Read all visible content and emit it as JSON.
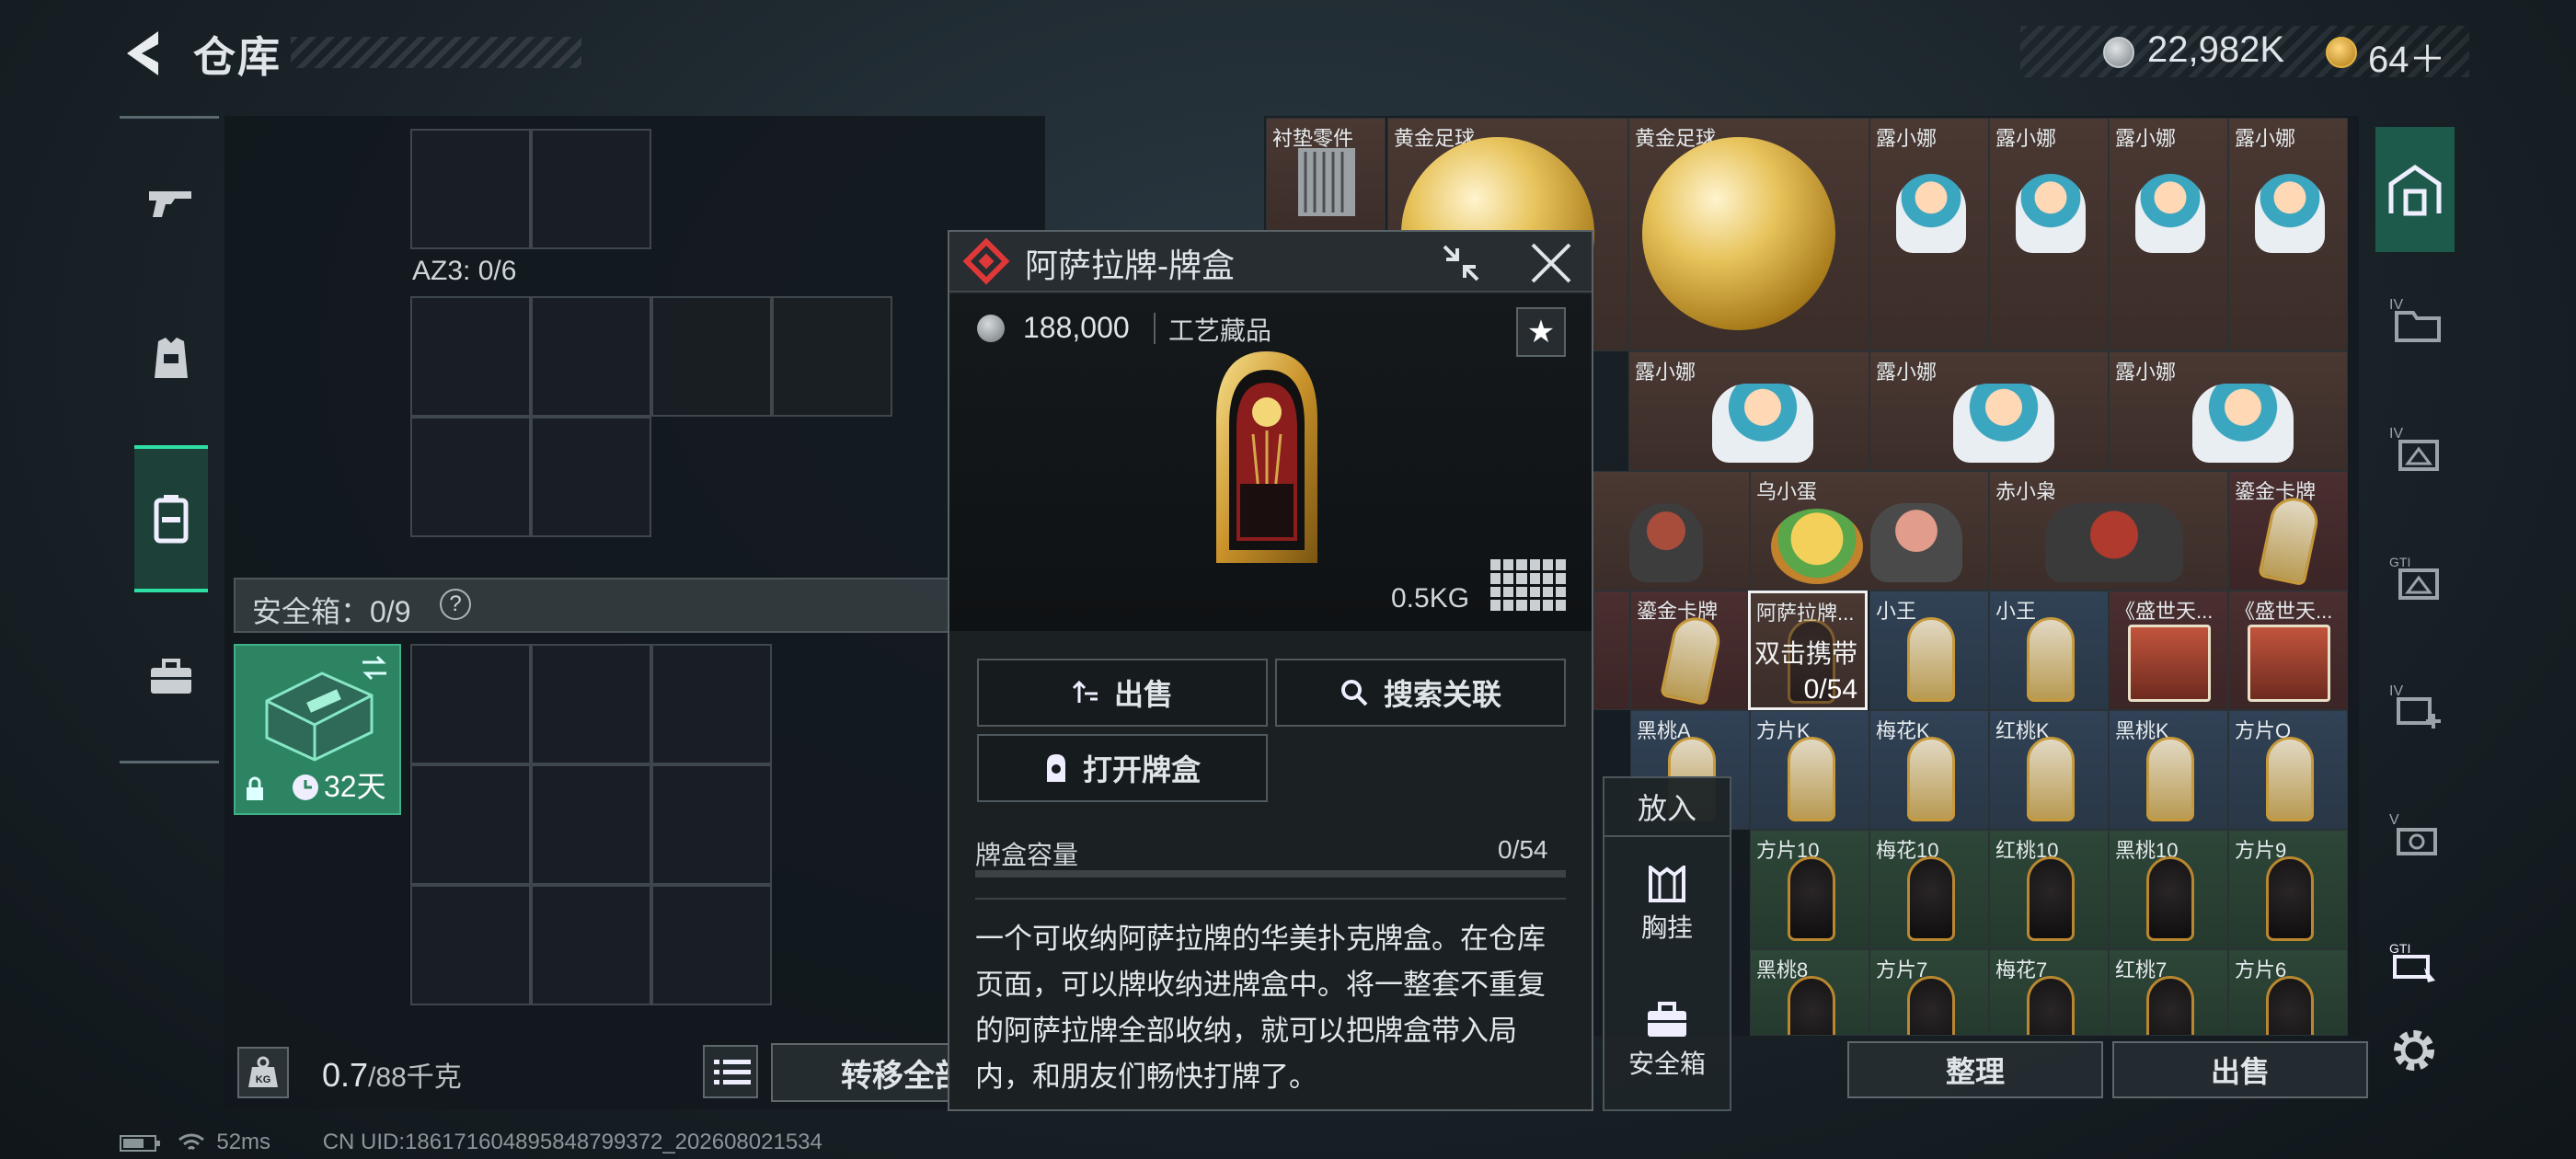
{
  "header": {
    "title": "仓库",
    "currency_silver": "22,982K",
    "currency_gold": "64＋"
  },
  "left_panel": {
    "az3_label": "AZ3: 0/6",
    "safebox_label": "安全箱：0/9",
    "safebox_help": "?",
    "safebox_days": "32天",
    "weight_current": "0.7",
    "weight_max": "/88千克",
    "transfer_label": "转移全部"
  },
  "right_grid": {
    "row0": [
      "衬垫零件",
      "黄金足球",
      "黄金足球",
      "露小娜",
      "露小娜",
      "露小娜",
      "露小娜"
    ],
    "row1": [
      "露小娜",
      "露小娜",
      "露小娜"
    ],
    "row2": [
      "乌小蛋",
      "赤小枭",
      "鎏金卡牌"
    ],
    "row3": [
      "鎏金卡牌",
      "阿萨拉牌...",
      "小王",
      "小王",
      "《盛世天...",
      "《盛世天..."
    ],
    "row4": [
      "黑桃A",
      "方片K",
      "梅花K",
      "红桃K",
      "黑桃K",
      "方片Q"
    ],
    "row5": [
      "方片10",
      "梅花10",
      "红桃10",
      "黑桃10",
      "方片9"
    ],
    "row6": [
      "黑桃8",
      "方片7",
      "梅花7",
      "红桃7",
      "方片6"
    ],
    "selected_overlay": "双击携带",
    "selected_count": "0/54",
    "sort_label": "整理",
    "sell_label": "出售"
  },
  "putin_menu": {
    "header": "放入",
    "option1": "胸挂",
    "option2": "安全箱"
  },
  "popup": {
    "title": "阿萨拉牌-牌盒",
    "price": "188,000",
    "category": "工艺藏品",
    "star": "★",
    "weight": "0.5KG",
    "sell_button": "出售",
    "search_button": "搜索关联",
    "open_button": "打开牌盒",
    "capacity_label": "牌盒容量",
    "capacity_value": "0/54",
    "capacity_fraction": 0,
    "description": "一个可收纳阿萨拉牌的华美扑克牌盒。在仓库页面，可以牌收纳进牌盒中。将一整套不重复的阿萨拉牌全部收纳，就可以把牌盒带入局内，和朋友们畅快打牌了。"
  },
  "status_bar": {
    "ping": "52ms",
    "uid": "CN UID:1861716048958487993​72_202608021534"
  },
  "colors": {
    "accent_green": "#2fe0a5",
    "alert_red": "#e03838",
    "gold": "#e6b544"
  }
}
